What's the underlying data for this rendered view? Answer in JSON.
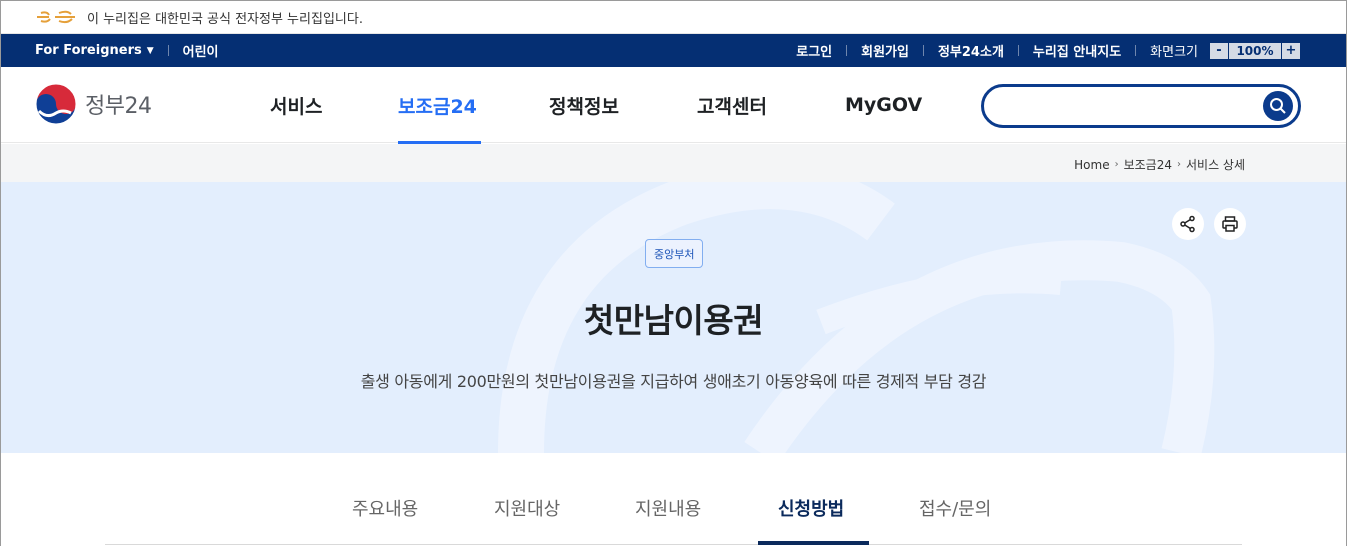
{
  "gov_notice": {
    "text": "이 누리집은 대한민국 공식 전자정부 누리집입니다.",
    "logo_icon": "egov-logo-icon"
  },
  "utility": {
    "foreigners": "For Foreigners",
    "kids": "어린이",
    "login": "로그인",
    "signup": "회원가입",
    "about": "정부24소개",
    "sitemap": "누리집 안내지도",
    "zoom_label": "화면크기",
    "zoom_minus": "-",
    "zoom_value": "100%",
    "zoom_plus": "+"
  },
  "header": {
    "logo_text": "정부24",
    "nav": [
      "서비스",
      "보조금24",
      "정책정보",
      "고객센터",
      "MyGOV"
    ],
    "active_nav": "보조금24",
    "search": {
      "value": "",
      "placeholder": ""
    }
  },
  "breadcrumb": [
    "Home",
    "보조금24",
    "서비스 상세"
  ],
  "hero": {
    "badge": "중앙부처",
    "title": "첫만남이용권",
    "description": "출생 아동에게 200만원의 첫만남이용권을 지급하여 생애초기 아동양육에 따른 경제적 부담 경감",
    "share_icon": "share-icon",
    "print_icon": "print-icon"
  },
  "tabs": [
    "주요내용",
    "지원대상",
    "지원내용",
    "신청방법",
    "접수/문의"
  ],
  "active_tab": "신청방법",
  "colors": {
    "util_bar": "#052f73",
    "accent": "#256ef4",
    "hero_bg": "#e3eefd",
    "search_border": "#0b3b8c"
  }
}
